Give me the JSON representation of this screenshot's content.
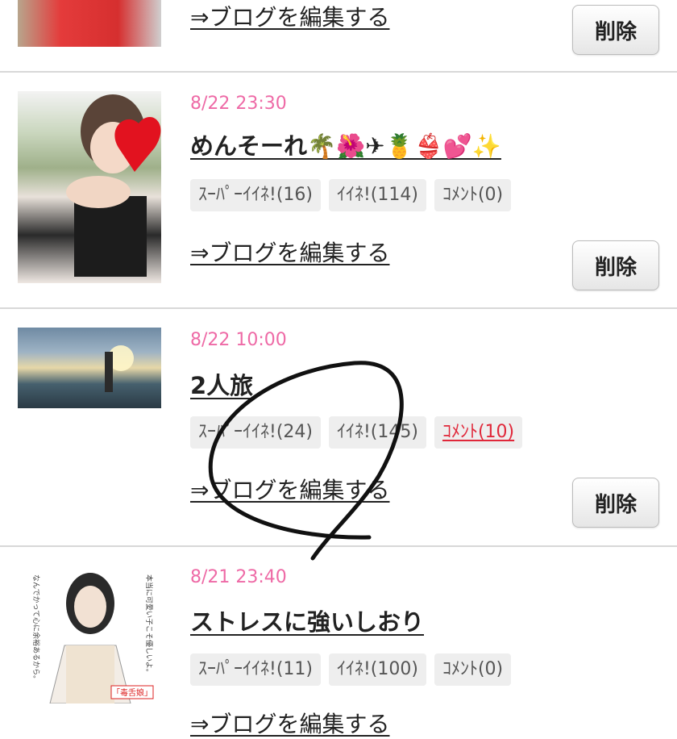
{
  "entries": [
    {
      "date": "",
      "title": "",
      "badges": [],
      "edit_link": "⇒ブログを編集する",
      "delete_label": "削除"
    },
    {
      "date": "8/22 23:30",
      "title": "めんそーれ🌴🌺✈🍍👙💕✨",
      "badges": [
        "ｽｰﾊﾟｰｲｲﾈ!(16)",
        "ｲｲﾈ!(114)",
        "ｺﾒﾝﾄ(0)"
      ],
      "edit_link": "⇒ブログを編集する",
      "delete_label": "削除"
    },
    {
      "date": "8/22 10:00",
      "title": "2人旅",
      "badges": [
        "ｽｰﾊﾟｰｲｲﾈ!(24)",
        "ｲｲﾈ!(145)",
        "ｺﾒﾝﾄ(10)"
      ],
      "edit_link": "⇒ブログを編集する",
      "delete_label": "削除"
    },
    {
      "date": "8/21 23:40",
      "title": "ストレスに強いしおり",
      "badges": [
        "ｽｰﾊﾟｰｲｲﾈ!(11)",
        "ｲｲﾈ!(100)",
        "ｺﾒﾝﾄ(0)"
      ],
      "edit_link": "⇒ブログを編集する",
      "delete_label": "削除"
    }
  ],
  "poster": {
    "vertical_left": "なんでかって心に余裕あるから。",
    "vertical_right": "本当に可愛い子こそ優しいよ。",
    "stamp": "「毒舌娘」"
  },
  "colors": {
    "date": "#ee6aa6",
    "comment_active": "#e0283a"
  }
}
